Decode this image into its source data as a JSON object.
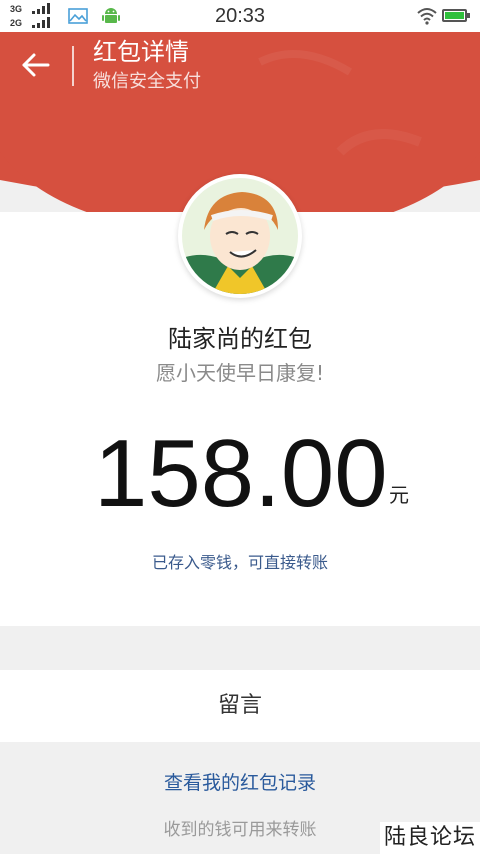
{
  "status_bar": {
    "network_1": "3G",
    "network_2": "2G",
    "time": "20:33",
    "icons": [
      "image-icon",
      "android-icon",
      "wifi-icon",
      "battery-icon"
    ]
  },
  "header": {
    "title": "红包详情",
    "subtitle": "微信安全支付",
    "back_icon": "arrow-left-icon"
  },
  "packet": {
    "sender_name": "陆家尚的红包",
    "greeting": "愿小天使早日康复!",
    "amount": "158.00",
    "unit": "元",
    "saved_note": "已存入零钱，可直接转账"
  },
  "actions": {
    "message_label": "留言",
    "history_link": "查看我的红包记录",
    "hint": "收到的钱可用来转账"
  },
  "watermark": "陆良论坛",
  "colors": {
    "accent_red": "#d6503f",
    "link_blue": "#2a5a9c",
    "background": "#f0f0f0"
  }
}
